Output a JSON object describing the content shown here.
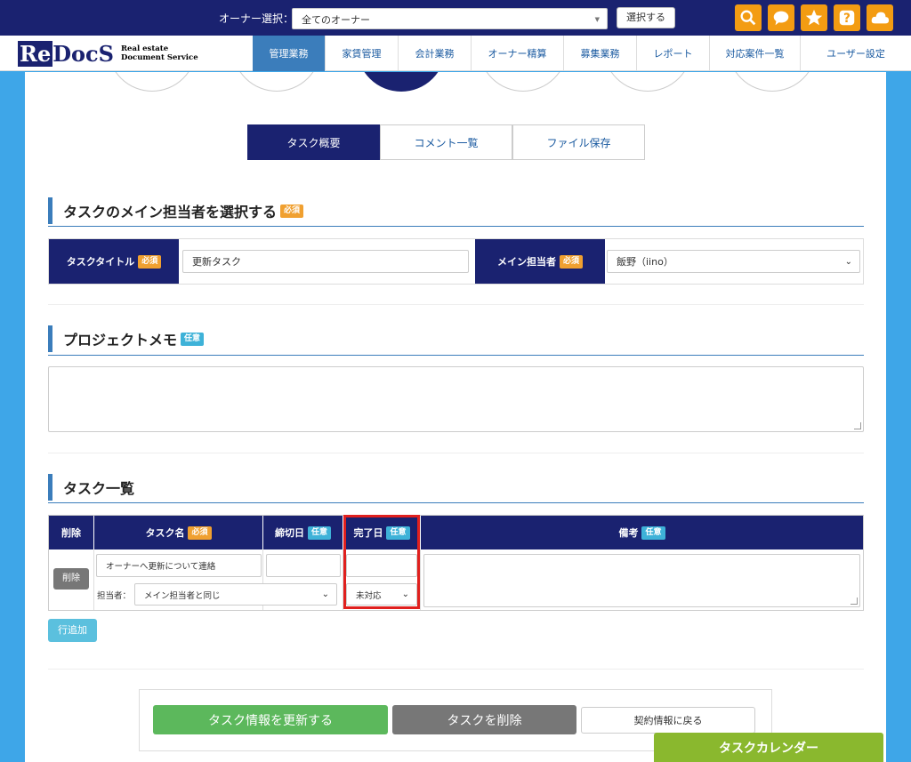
{
  "topbar": {
    "owner_label": "オーナー選択：",
    "owner_select_value": "全てのオーナー",
    "select_button": "選択する",
    "icons": [
      "search-icon",
      "chat-icon",
      "star-icon",
      "help-icon",
      "cloud-icon"
    ],
    "accent_color": "#f39c12"
  },
  "logo": {
    "name_re": "Re",
    "name_docs": "DocS",
    "sub1": "Real estate",
    "sub2": "Document Service"
  },
  "nav": {
    "tabs": [
      {
        "label": "管理業務",
        "active": true
      },
      {
        "label": "家賃管理"
      },
      {
        "label": "会計業務"
      },
      {
        "label": "オーナー精算"
      },
      {
        "label": "募集業務"
      },
      {
        "label": "レポート"
      },
      {
        "label": "対応案件一覧"
      },
      {
        "label": "ユーザー設定"
      }
    ]
  },
  "tabs": {
    "overview": "タスク概要",
    "comments": "コメント一覧",
    "files": "ファイル保存"
  },
  "badges": {
    "required": "必須",
    "optional": "任意"
  },
  "section_assignee": {
    "title": "タスクのメイン担当者を選択する",
    "task_title_label": "タスクタイトル",
    "task_title_value": "更新タスク",
    "main_assignee_label": "メイン担当者",
    "main_assignee_value": "飯野（iino）"
  },
  "section_memo": {
    "title": "プロジェクトメモ",
    "value": ""
  },
  "section_tasks": {
    "title": "タスク一覧",
    "columns": {
      "delete": "削除",
      "task_name": "タスク名",
      "deadline": "締切日",
      "completed": "完了日",
      "note": "備考"
    },
    "rows": [
      {
        "delete_label": "削除",
        "task_name": "オーナーへ更新について連絡",
        "assignee_label": "担当者：",
        "assignee_value": "メイン担当者と同じ",
        "deadline": "",
        "completed": "",
        "status": "未対応",
        "note": ""
      }
    ],
    "add_row": "行追加"
  },
  "footer": {
    "update": "タスク情報を更新する",
    "delete": "タスクを削除",
    "back": "契約情報に戻る"
  },
  "calendar_button": "タスクカレンダー"
}
